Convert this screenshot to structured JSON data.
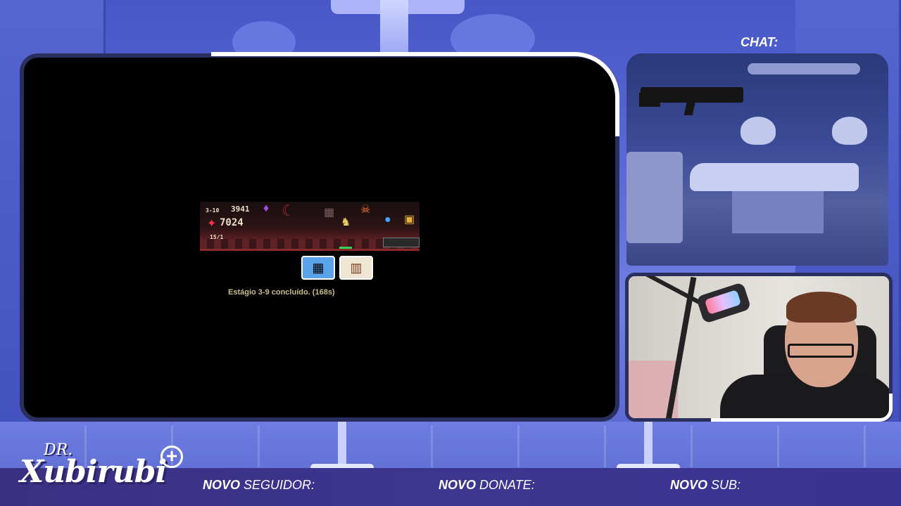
{
  "game": {
    "stage_label": "3-10",
    "gold": "3941",
    "score": "7024",
    "hp": "15/1",
    "status_text": "Estágio 3-9 concluído. (168s)"
  },
  "chat": {
    "title": "CHAT:"
  },
  "branding": {
    "dr": "DR.",
    "name": "Xubirubi"
  },
  "alerts": [
    {
      "prefix": "NOVO",
      "suffix": "SEGUIDOR:"
    },
    {
      "prefix": "NOVO",
      "suffix": "DONATE:"
    },
    {
      "prefix": "NOVO",
      "suffix": "SUB:"
    }
  ],
  "colors": {
    "frame_border": "#2a2f5e",
    "bottom_bar": "#3b2f83",
    "accent_white": "#ffffff"
  }
}
